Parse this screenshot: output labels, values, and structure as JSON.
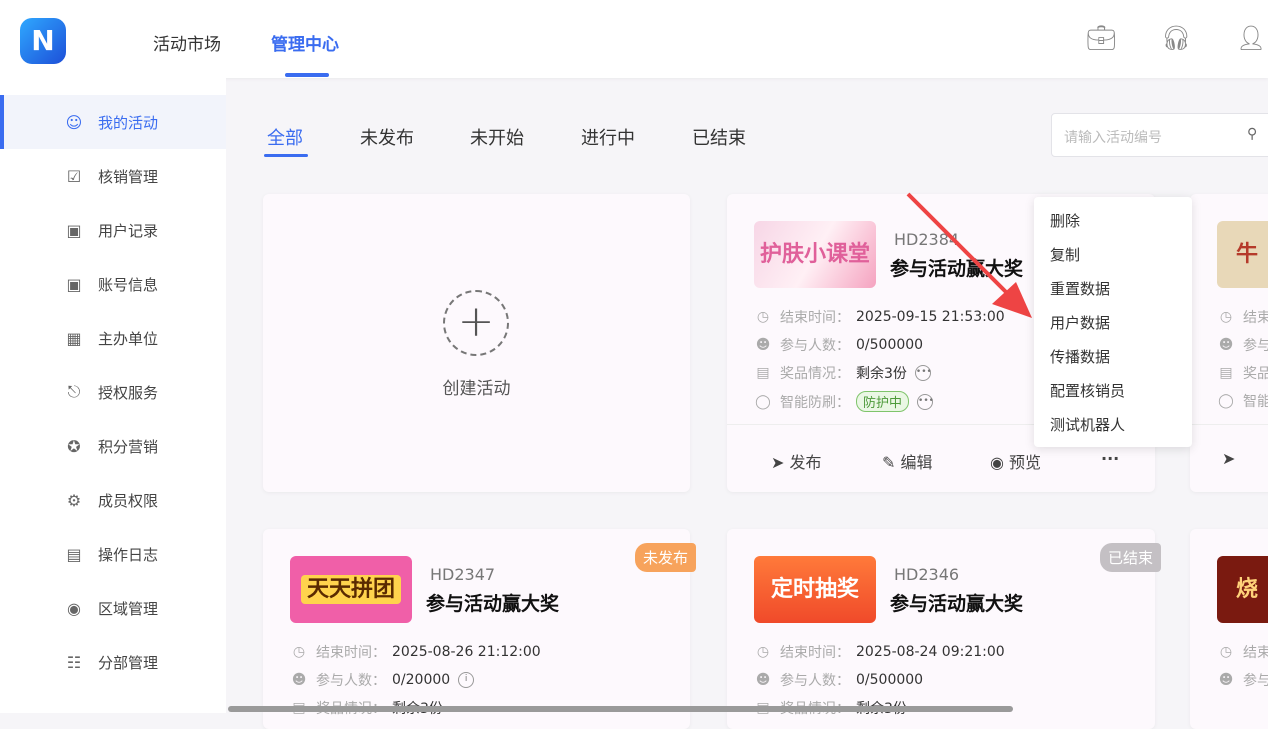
{
  "header": {
    "logo": "N",
    "nav": [
      "活动市场",
      "管理中心"
    ],
    "active_nav": 1,
    "icons": [
      "briefcase-icon",
      "headset-icon",
      "user-icon"
    ]
  },
  "sidebar": {
    "items": [
      {
        "label": "我的活动",
        "icon": "user-icon",
        "active": true
      },
      {
        "label": "核销管理",
        "icon": "clipboard-check-icon"
      },
      {
        "label": "用户记录",
        "icon": "user-card-icon"
      },
      {
        "label": "账号信息",
        "icon": "id-card-icon"
      },
      {
        "label": "主办单位",
        "icon": "building-icon"
      },
      {
        "label": "授权服务",
        "icon": "stamp-icon"
      },
      {
        "label": "积分营销",
        "icon": "star-badge-icon"
      },
      {
        "label": "成员权限",
        "icon": "user-gear-icon"
      },
      {
        "label": "操作日志",
        "icon": "calendar-log-icon"
      },
      {
        "label": "区域管理",
        "icon": "location-icon"
      },
      {
        "label": "分部管理",
        "icon": "org-chart-icon"
      }
    ]
  },
  "tabs": [
    "全部",
    "未发布",
    "未开始",
    "进行中",
    "已结束"
  ],
  "search": {
    "placeholder": "请输入活动编号"
  },
  "create": {
    "label": "创建活动"
  },
  "labels": {
    "end_time": "结束时间：",
    "participants": "参与人数：",
    "prizes": "奖品情况：",
    "antibrush": "智能防刷：",
    "publish": "发布",
    "edit": "编辑",
    "preview": "预览"
  },
  "cards": [
    {
      "code": "HD2384",
      "title": "参与活动赢大奖",
      "thumb": "护肤小课堂",
      "end_time": "2025-09-15 21:53:00",
      "participants": "0/500000",
      "prizes": "剩余3份",
      "antibrush": "防护中"
    },
    {
      "code": "HD2347",
      "title": "参与活动赢大奖",
      "thumb": "天天拼团",
      "end_time": "2025-08-26 21:12:00",
      "participants": "0/20000",
      "prizes": "剩余3份",
      "badge": "未发布",
      "badge_color": "#f7a35c"
    },
    {
      "code": "HD2346",
      "title": "参与活动赢大奖",
      "thumb": "定时抽奖",
      "end_time": "2025-08-24 09:21:00",
      "participants": "0/500000",
      "prizes": "剩余3份",
      "badge": "已结束",
      "badge_color": "#c4c0c4"
    }
  ],
  "partial_labels": {
    "end": "结束",
    "join": "参与",
    "prize": "奖品",
    "smart": "智能"
  },
  "dropdown": [
    "删除",
    "复制",
    "重置数据",
    "用户数据",
    "传播数据",
    "配置核销员",
    "测试机器人"
  ]
}
